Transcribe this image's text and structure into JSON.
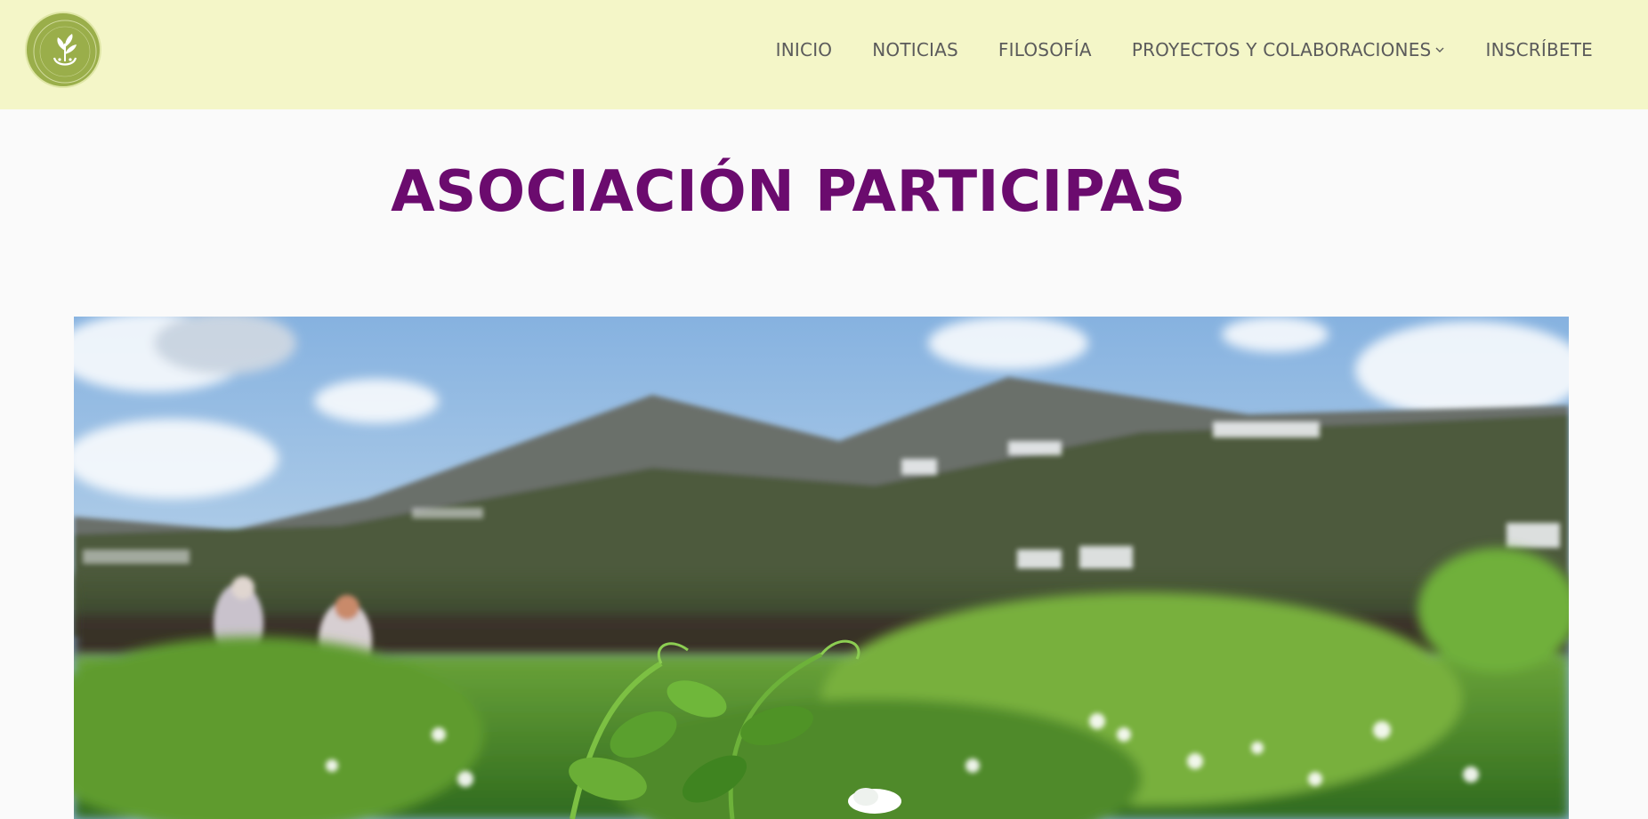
{
  "header": {
    "logo_text": "ASOCIACIÓN PARTICIPAS",
    "nav": [
      {
        "label": "INICIO"
      },
      {
        "label": "NOTICIAS"
      },
      {
        "label": "FILOSOFÍA"
      },
      {
        "label": "PROYECTOS Y COLABORACIONES",
        "has_dropdown": true
      },
      {
        "label": "INSCRÍBETE"
      }
    ]
  },
  "main": {
    "title": "ASOCIACIÓN PARTICIPAS"
  },
  "colors": {
    "header_bg": "#f4f6c8",
    "title": "#6b0b6e",
    "nav_text": "#5b5b5b",
    "logo_bg": "#9aae4a"
  },
  "icons": {
    "logo": "leaf-plant-icon",
    "dropdown": "chevron-down-icon"
  }
}
